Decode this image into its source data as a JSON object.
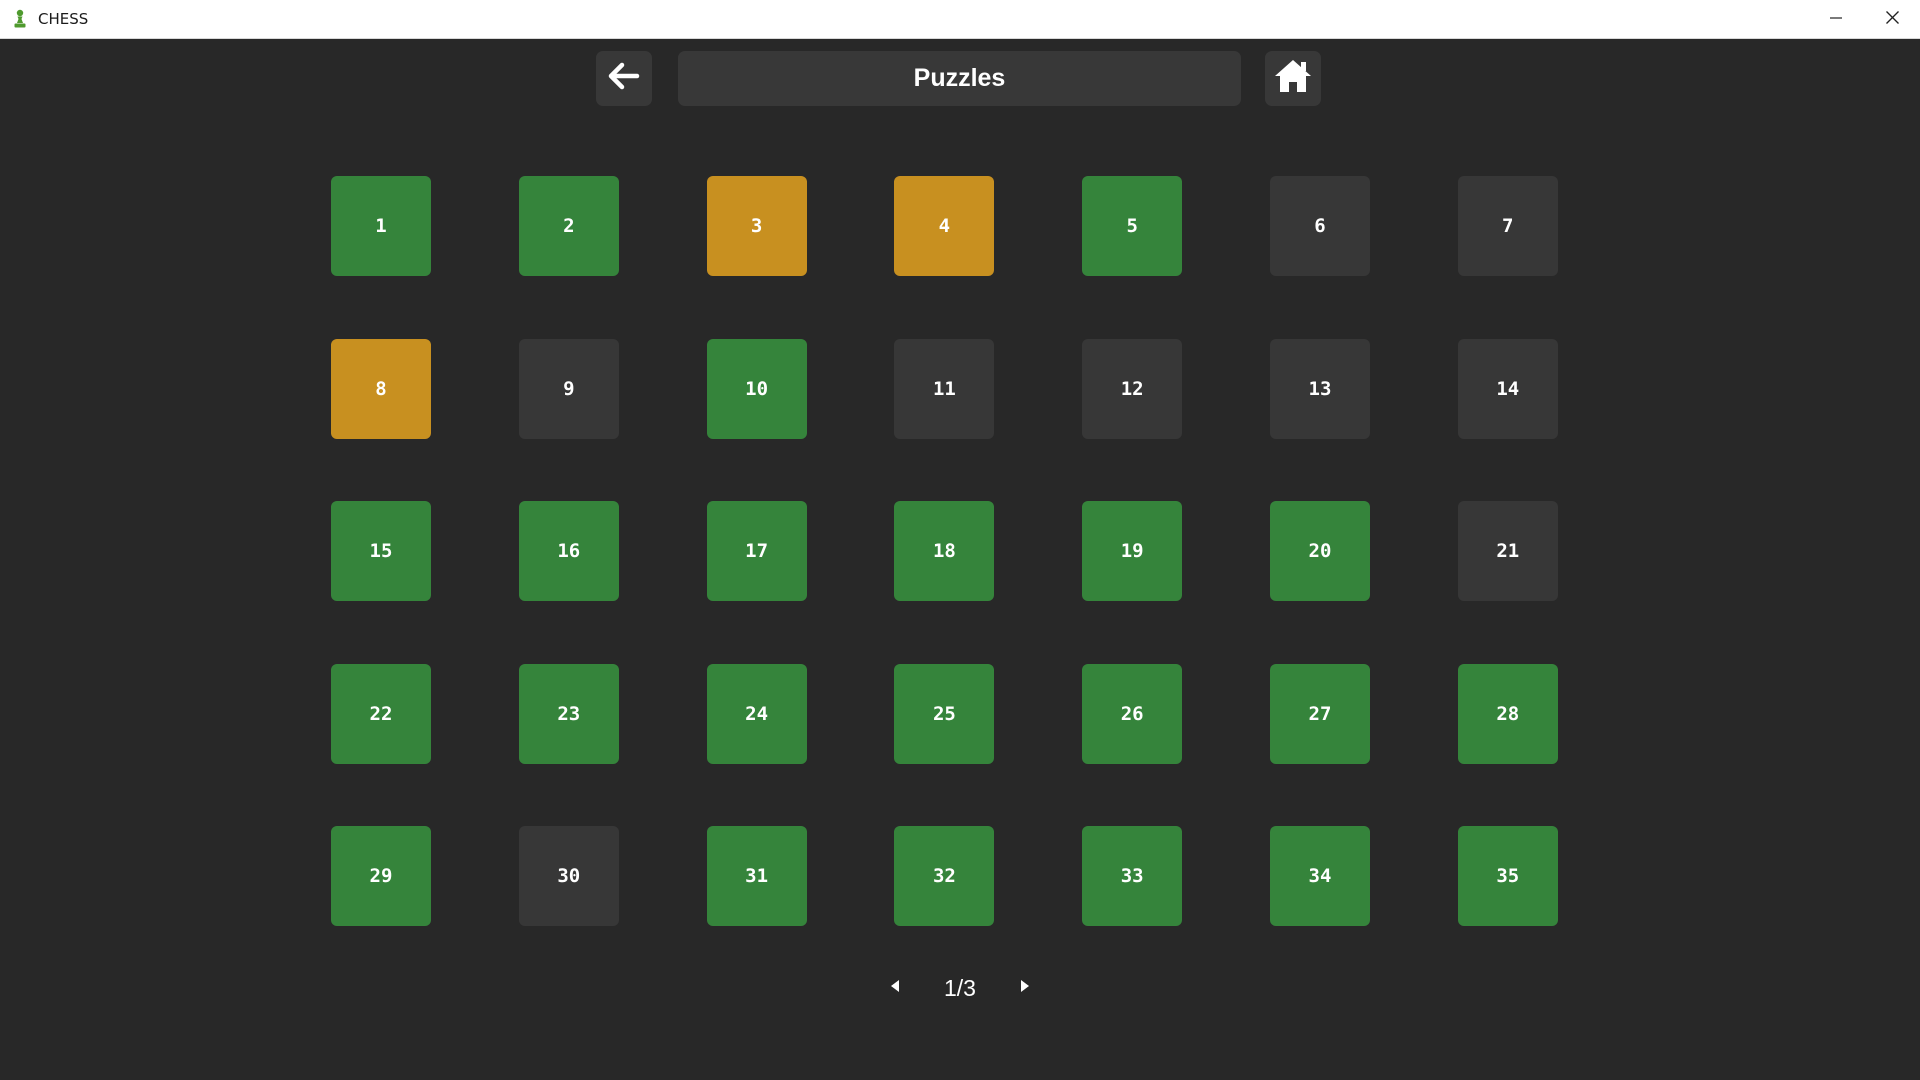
{
  "window": {
    "title": "CHESS",
    "controls": [
      "minimize-icon",
      "close-icon"
    ]
  },
  "header": {
    "title": "Puzzles",
    "back_icon": "arrow-left-icon",
    "home_icon": "home-icon"
  },
  "colors": {
    "background": "#282828",
    "solved": "#35843b",
    "attempted": "#c89020",
    "unsolved": "#373737",
    "panel": "#383838"
  },
  "puzzles": [
    {
      "label": "1",
      "status": "solved"
    },
    {
      "label": "2",
      "status": "solved"
    },
    {
      "label": "3",
      "status": "attempted"
    },
    {
      "label": "4",
      "status": "attempted"
    },
    {
      "label": "5",
      "status": "solved"
    },
    {
      "label": "6",
      "status": "unsolved"
    },
    {
      "label": "7",
      "status": "unsolved"
    },
    {
      "label": "8",
      "status": "attempted"
    },
    {
      "label": "9",
      "status": "unsolved"
    },
    {
      "label": "10",
      "status": "solved"
    },
    {
      "label": "11",
      "status": "unsolved"
    },
    {
      "label": "12",
      "status": "unsolved"
    },
    {
      "label": "13",
      "status": "unsolved"
    },
    {
      "label": "14",
      "status": "unsolved"
    },
    {
      "label": "15",
      "status": "solved"
    },
    {
      "label": "16",
      "status": "solved"
    },
    {
      "label": "17",
      "status": "solved"
    },
    {
      "label": "18",
      "status": "solved"
    },
    {
      "label": "19",
      "status": "solved"
    },
    {
      "label": "20",
      "status": "solved"
    },
    {
      "label": "21",
      "status": "unsolved"
    },
    {
      "label": "22",
      "status": "solved"
    },
    {
      "label": "23",
      "status": "solved"
    },
    {
      "label": "24",
      "status": "solved"
    },
    {
      "label": "25",
      "status": "solved"
    },
    {
      "label": "26",
      "status": "solved"
    },
    {
      "label": "27",
      "status": "solved"
    },
    {
      "label": "28",
      "status": "solved"
    },
    {
      "label": "29",
      "status": "solved"
    },
    {
      "label": "30",
      "status": "unsolved"
    },
    {
      "label": "31",
      "status": "solved"
    },
    {
      "label": "32",
      "status": "solved"
    },
    {
      "label": "33",
      "status": "solved"
    },
    {
      "label": "34",
      "status": "solved"
    },
    {
      "label": "35",
      "status": "solved"
    }
  ],
  "pagination": {
    "indicator": "1/3",
    "prev_icon": "caret-left-icon",
    "next_icon": "caret-right-icon"
  }
}
